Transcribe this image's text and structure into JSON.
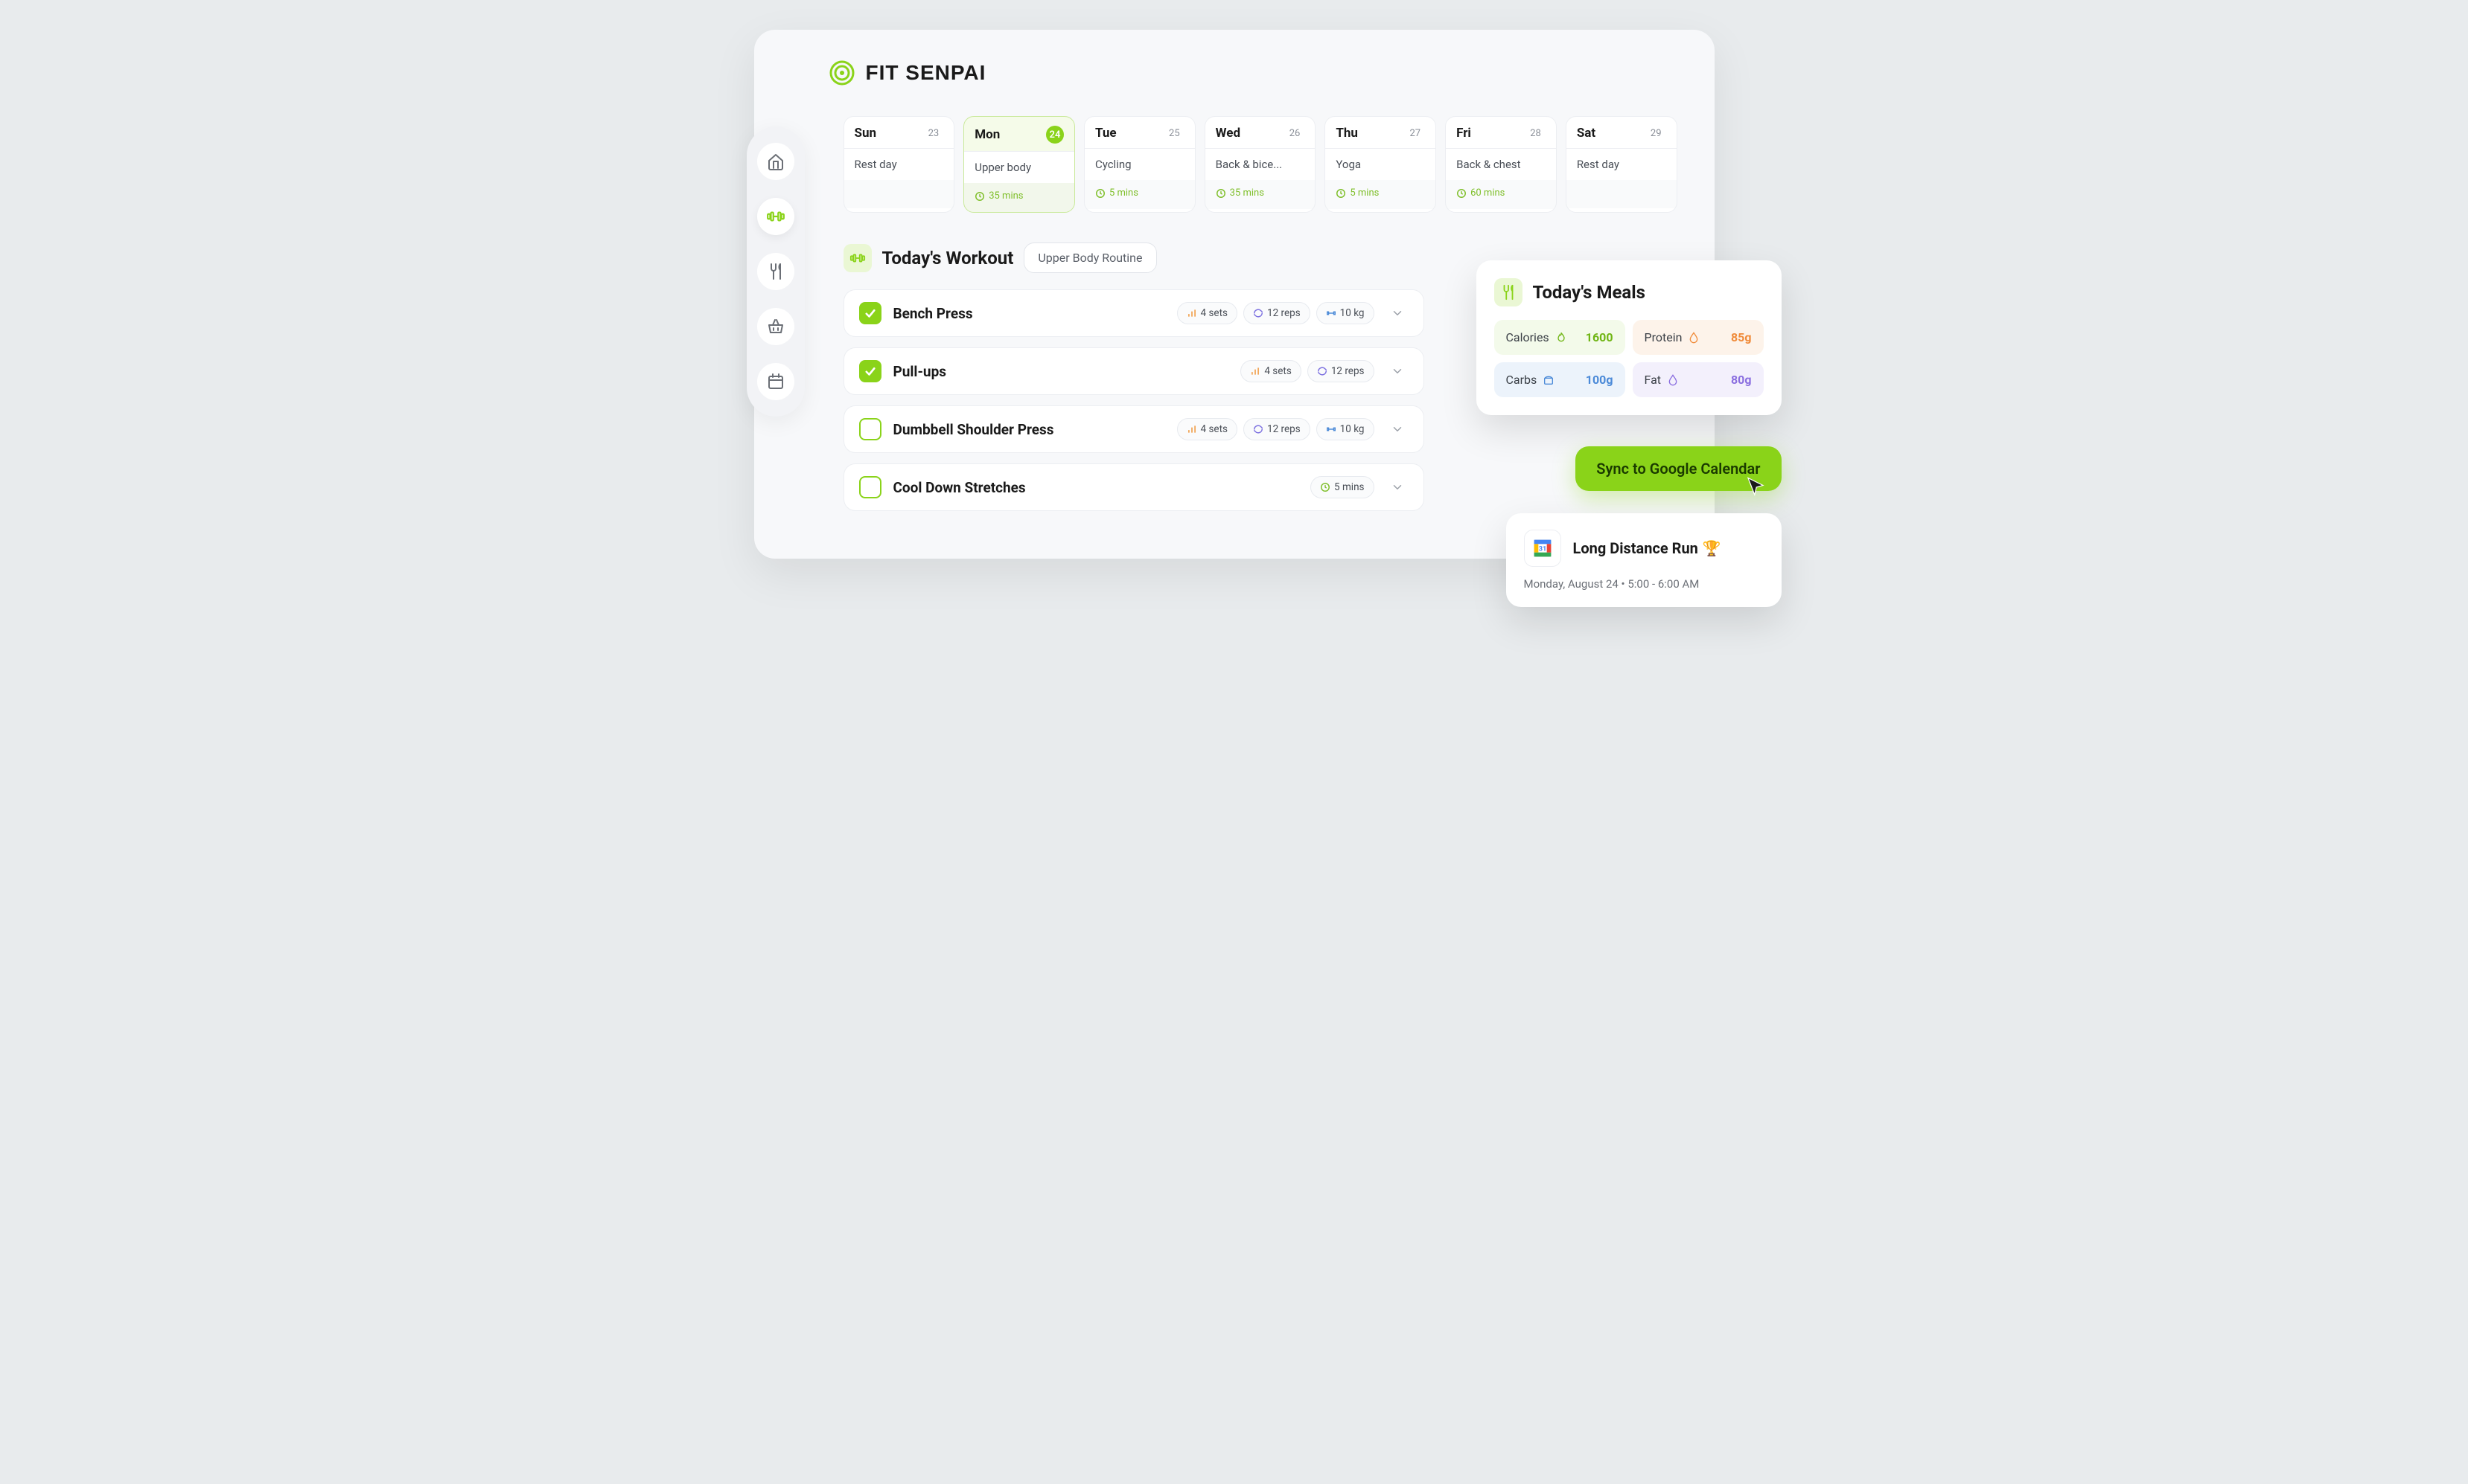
{
  "brand": {
    "name": "FIT SENPAI"
  },
  "sidebar": {
    "items": [
      {
        "name": "home"
      },
      {
        "name": "workouts",
        "active": true
      },
      {
        "name": "meals"
      },
      {
        "name": "shopping"
      },
      {
        "name": "calendar"
      }
    ]
  },
  "week": [
    {
      "day": "Sun",
      "date": "23",
      "activity": "Rest day",
      "duration": ""
    },
    {
      "day": "Mon",
      "date": "24",
      "activity": "Upper body",
      "duration": "35 mins",
      "active": true
    },
    {
      "day": "Tue",
      "date": "25",
      "activity": "Cycling",
      "duration": "5 mins"
    },
    {
      "day": "Wed",
      "date": "26",
      "activity": "Back & bice...",
      "duration": "35 mins"
    },
    {
      "day": "Thu",
      "date": "27",
      "activity": "Yoga",
      "duration": "5 mins"
    },
    {
      "day": "Fri",
      "date": "28",
      "activity": "Back & chest",
      "duration": "60 mins"
    },
    {
      "day": "Sat",
      "date": "29",
      "activity": "Rest day",
      "duration": ""
    }
  ],
  "workout": {
    "title": "Today's Workout",
    "routine": "Upper Body Routine",
    "exercises": [
      {
        "name": "Bench Press",
        "checked": true,
        "sets": "4 sets",
        "reps": "12 reps",
        "weight": "10 kg"
      },
      {
        "name": "Pull-ups",
        "checked": true,
        "sets": "4 sets",
        "reps": "12 reps",
        "weight": ""
      },
      {
        "name": "Dumbbell Shoulder Press",
        "checked": false,
        "sets": "4 sets",
        "reps": "12 reps",
        "weight": "10 kg"
      },
      {
        "name": "Cool Down Stretches",
        "checked": false,
        "duration": "5 mins"
      }
    ]
  },
  "meals": {
    "title": "Today's Meals",
    "macros": {
      "calories": {
        "label": "Calories",
        "value": "1600"
      },
      "protein": {
        "label": "Protein",
        "value": "85g"
      },
      "carbs": {
        "label": "Carbs",
        "value": "100g"
      },
      "fat": {
        "label": "Fat",
        "value": "80g"
      }
    }
  },
  "sync": {
    "label": "Sync to Google Calendar"
  },
  "event": {
    "title": "Long Distance Run",
    "emoji": "🏆",
    "datetime": "Monday, August 24 • 5:00 - 6:00 AM",
    "cal_day": "31"
  }
}
